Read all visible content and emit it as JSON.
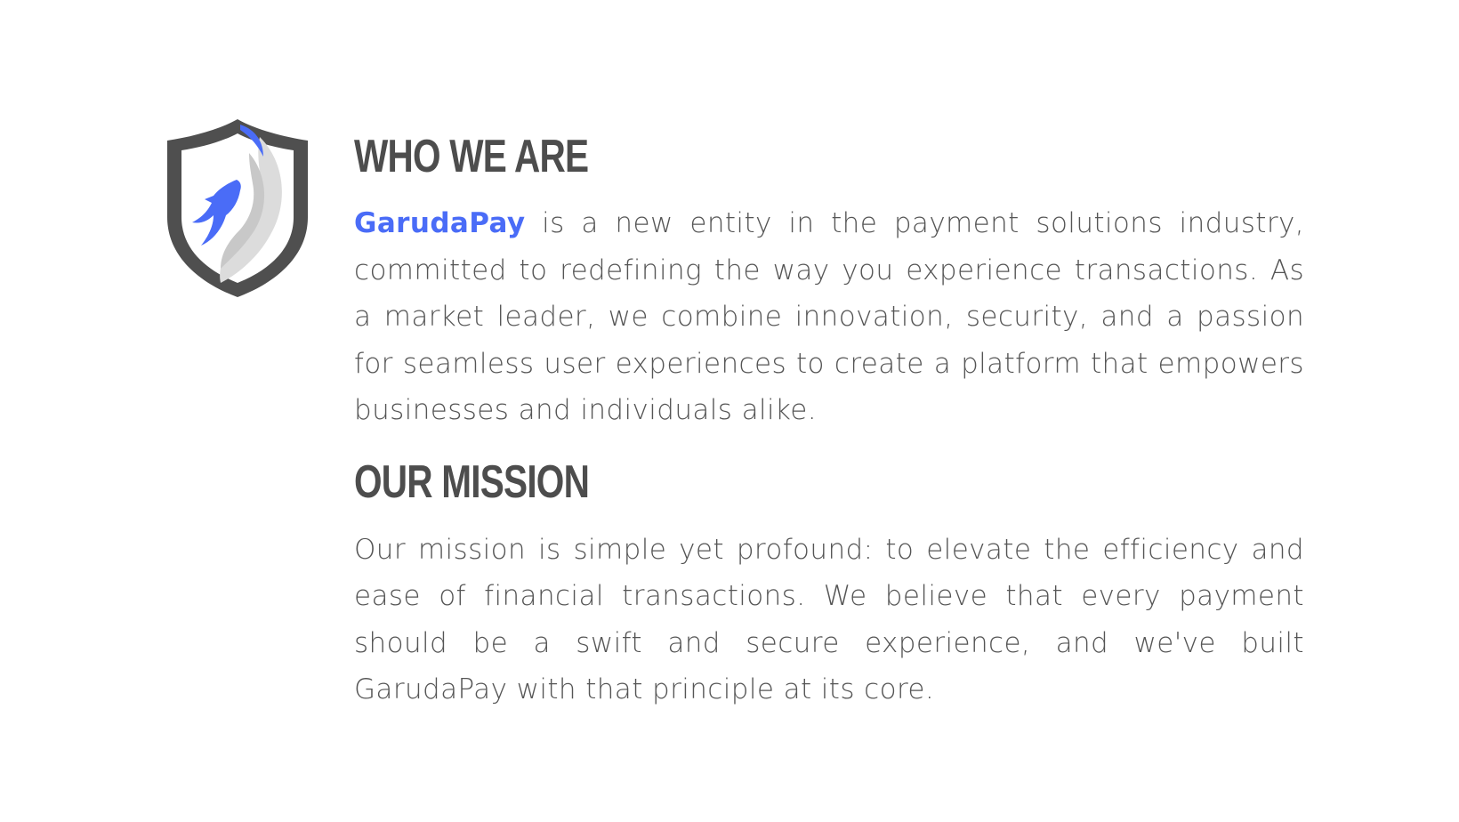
{
  "colors": {
    "brand": "#4a6cf7",
    "heading": "#4d4d4d",
    "text": "#555555",
    "shield_dark": "#4f4f4f",
    "wing_light": "#dcdcdc"
  },
  "logo": {
    "icon": "garuda-shield-logo-icon"
  },
  "who_we_are": {
    "heading": "WHO WE ARE",
    "brand_name": "GarudaPay",
    "body": " is a new entity in the payment solutions industry, committed to redefining the way you experience transactions. As a market leader, we combine innovation, security, and a passion for seamless user experiences to create a platform that empowers businesses and individuals alike."
  },
  "our_mission": {
    "heading": "OUR MISSION",
    "body": "Our mission is simple yet profound: to elevate the efficiency and ease of financial transactions. We believe that every payment should be a swift and secure experience, and we've built GarudaPay with that principle at its core."
  }
}
